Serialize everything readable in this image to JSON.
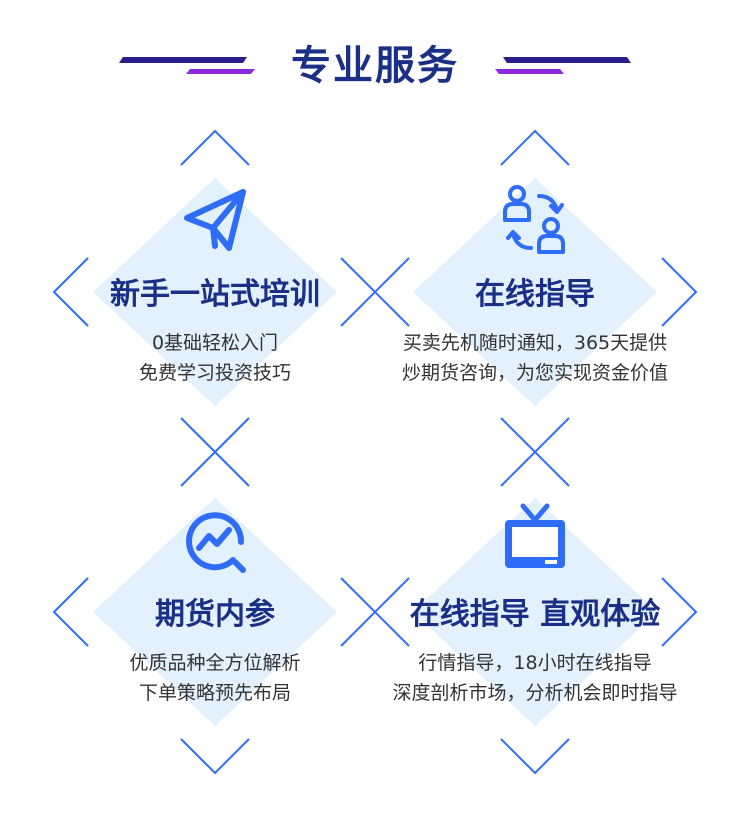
{
  "header": {
    "title": "专业服务"
  },
  "services": [
    {
      "title": "新手一站式培训",
      "line1": "0基础轻松入门",
      "line2": "免费学习投资技巧",
      "icon": "paper-plane-icon"
    },
    {
      "title": "在线指导",
      "line1": "买卖先机随时通知，365天提供",
      "line2": "炒期货咨询，为您实现资金价值",
      "icon": "user-exchange-icon"
    },
    {
      "title": "期货内参",
      "line1": "优质品种全方位解析",
      "line2": "下单策略预先布局",
      "icon": "trend-chart-icon"
    },
    {
      "title": "在线指导 直观体验",
      "line1": "行情指导，18小时在线指导",
      "line2": "深度剖析市场，分析机会即时指导",
      "icon": "tv-icon"
    }
  ],
  "colors": {
    "primary_blue": "#2f6df6",
    "title_navy": "#1b2f86",
    "diamond_fill": "#e3f1fe",
    "accent_purple": "#7b2ff2",
    "body_text": "#333333"
  }
}
